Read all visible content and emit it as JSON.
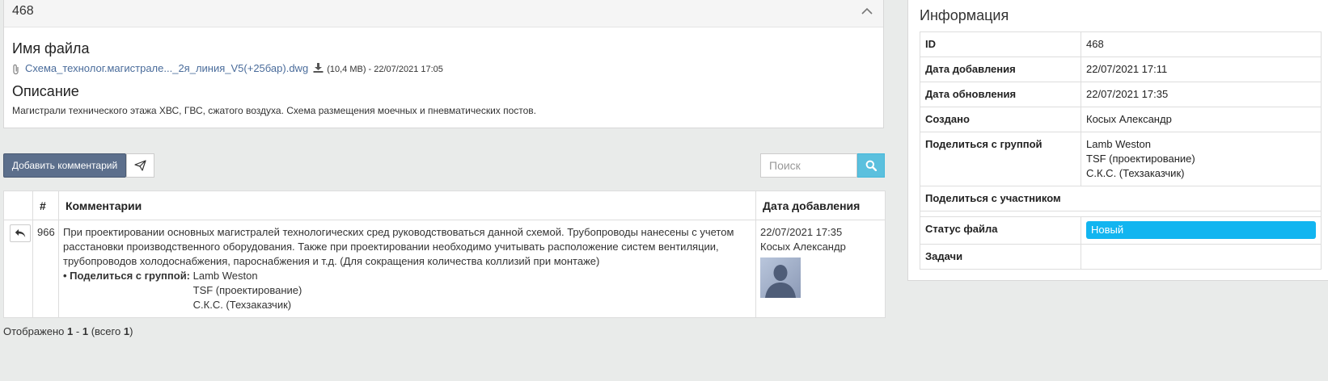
{
  "file": {
    "id": "468",
    "filename_heading": "Имя файла",
    "filename": "Схема_технолог.магистрале..._2я_линия_V5(+25бар).dwg",
    "file_meta": "(10,4 MB) - 22/07/2021 17:05",
    "description_heading": "Описание",
    "description": "Магистрали технического этажа ХВС, ГВС, сжатого воздуха. Схема размещения моечных и пневматических постов."
  },
  "toolbar": {
    "add_comment": "Добавить комментарий",
    "search_placeholder": "Поиск"
  },
  "comments": {
    "headers": {
      "num": "#",
      "comment": "Комментарии",
      "date": "Дата добавления"
    },
    "rows": [
      {
        "num": "966",
        "text": "При проектировании основных магистралей технологических сред руководствоваться данной схемой. Трубопроводы нанесены с учетом расстановки производственного оборудования. Также при проектировании необходимо учитывать расположение систем вентиляции, трубопроводов холодоснабжения, пароснабжения и т.д. (Для сокращения количества коллизий при монтаже)",
        "share_label": "• Поделиться с группой:",
        "share_groups": [
          "Lamb Weston",
          "TSF (проектирование)",
          "С.К.С. (Техзаказчик)"
        ],
        "date": "22/07/2021 17:35",
        "author": "Косых Александр"
      }
    ]
  },
  "pagination": {
    "prefix": "Отображено",
    "from": "1",
    "dash": "-",
    "to": "1",
    "total_prefix": "(всего",
    "total": "1",
    "total_suffix": ")"
  },
  "info": {
    "title": "Информация",
    "rows": {
      "id": {
        "label": "ID",
        "value": "468"
      },
      "added": {
        "label": "Дата добавления",
        "value": "22/07/2021 17:11"
      },
      "updated": {
        "label": "Дата обновления",
        "value": "22/07/2021 17:35"
      },
      "created_by": {
        "label": "Создано",
        "value": "Косых Александр"
      },
      "share_group": {
        "label": "Поделиться с группой",
        "values": [
          "Lamb Weston",
          "TSF (проектирование)",
          "С.К.С. (Техзаказчик)"
        ]
      },
      "share_member": {
        "label": "Поделиться с участником"
      },
      "status": {
        "label": "Статус файла",
        "value": "Новый"
      },
      "tasks": {
        "label": "Задачи"
      }
    }
  },
  "colors": {
    "add_button": "#5c6f8c",
    "search_button": "#5bc0de",
    "status_badge": "#12b5f0",
    "link": "#4a6c9b",
    "background": "#e9ebea"
  },
  "icons": {
    "collapse": "chevron-up-icon",
    "attachment": "paperclip-icon",
    "download": "download-icon",
    "send": "paper-plane-icon",
    "search": "search-icon",
    "reply": "reply-icon",
    "avatar": "user-avatar-placeholder"
  }
}
